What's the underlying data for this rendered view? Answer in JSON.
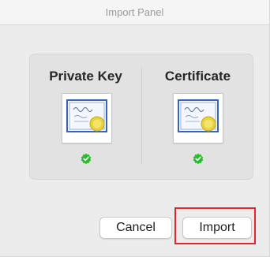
{
  "window": {
    "title": "Import Panel"
  },
  "panel": {
    "columns": [
      {
        "title": "Private Key",
        "icon": "certificate-icon",
        "status_icon": "green-checkmark-icon"
      },
      {
        "title": "Certificate",
        "icon": "certificate-icon",
        "status_icon": "green-checkmark-icon"
      }
    ]
  },
  "buttons": {
    "cancel_label": "Cancel",
    "import_label": "Import"
  },
  "colors": {
    "highlight": "#e3262b",
    "check": "#2dbb2d",
    "certificate_border": "#3a64b8",
    "seal": "#e8d23a"
  }
}
